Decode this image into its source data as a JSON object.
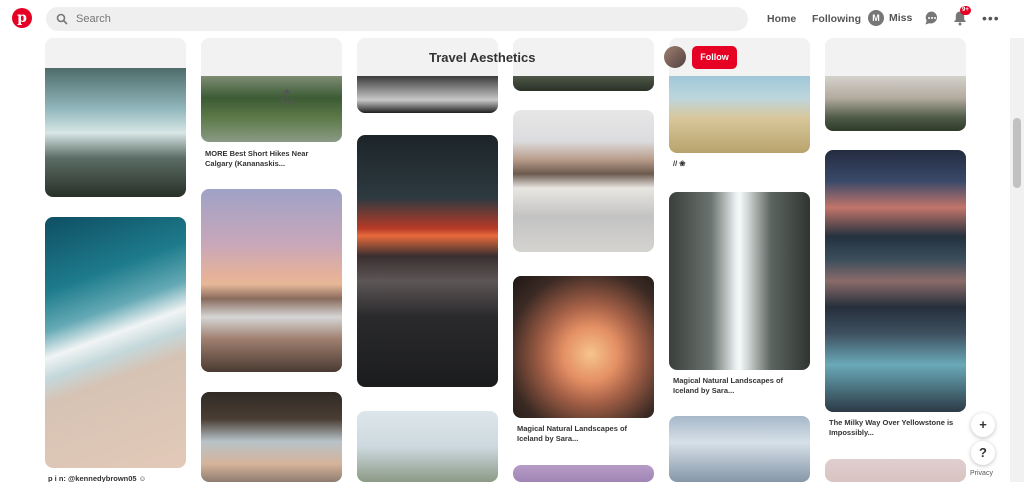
{
  "topbar": {
    "logo_letter": "p",
    "search_placeholder": "Search",
    "nav_home": "Home",
    "nav_following": "Following",
    "user_initial": "M",
    "user_name": "Miss",
    "notification_badge": "9+",
    "more": "•••"
  },
  "board": {
    "title": "Travel Aesthetics",
    "follow_label": "Follow"
  },
  "captions": {
    "c1": "MORE Best Short Hikes Near",
    "c1b": "Calgary (Kananaskis...",
    "c2": "// ❀",
    "c3": "Magical Natural Landscapes of",
    "c3b": "Iceland by Sara...",
    "c4": "Magical Natural Landscapes of",
    "c4b": "Iceland by Sara...",
    "c5": "The Milky Way Over Yellowstone is",
    "c5b": "Impossibly...",
    "c6": "p i n: @kennedybrown05 ☺"
  },
  "float": {
    "plus": "+",
    "help": "?",
    "privacy": "Privacy"
  },
  "colors": {
    "brand": "#e60023"
  }
}
